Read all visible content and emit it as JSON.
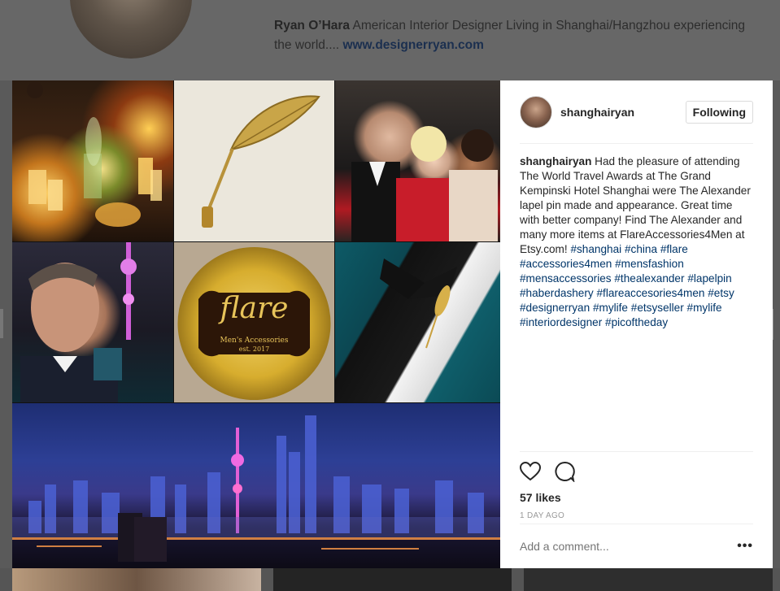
{
  "profile": {
    "name": "Ryan O’Hara",
    "bio": "American Interior Designer Living in Shanghai/Hangzhou experiencing the world....",
    "website": "www.designerryan.com"
  },
  "post": {
    "images": [
      "candles-dinner",
      "feather-lapel-pin",
      "gala-group-photo",
      "selfie-pearl-tower",
      "flare-mens-accessories-logo",
      "tuxedo-lapel-pin",
      "shanghai-skyline-night"
    ],
    "logo": {
      "title": "flare",
      "subtitle": "Men's Accessories",
      "est": "est. 2017"
    },
    "username": "shanghairyan",
    "follow_label": "Following",
    "caption_text": "Had the pleasure of attending The World Travel Awards at The Grand Kempinski Hotel Shanghai were The Alexander lapel pin made and appearance. Great time with better company! Find The Alexander and many more items at FlareAccessories4Men at Etsy.com!",
    "hashtags": [
      "#shanghai",
      "#china",
      "#flare",
      "#accessories4men",
      "#mensfashion",
      "#mensaccessories",
      "#thealexander",
      "#lapelpin",
      "#haberdashery",
      "#flareaccesories4men",
      "#etsy",
      "#designerryan",
      "#mylife",
      "#etsyseller",
      "#mylife",
      "#interiordesigner",
      "#picoftheday"
    ],
    "likes": "57 likes",
    "time_ago": "1 DAY AGO",
    "comment_placeholder": "Add a comment...",
    "more_label": "•••"
  },
  "colors": {
    "hashtag": "#003569",
    "text": "#262626",
    "muted": "#999999",
    "border": "#efefef",
    "overlay": "#5a5a5a"
  }
}
